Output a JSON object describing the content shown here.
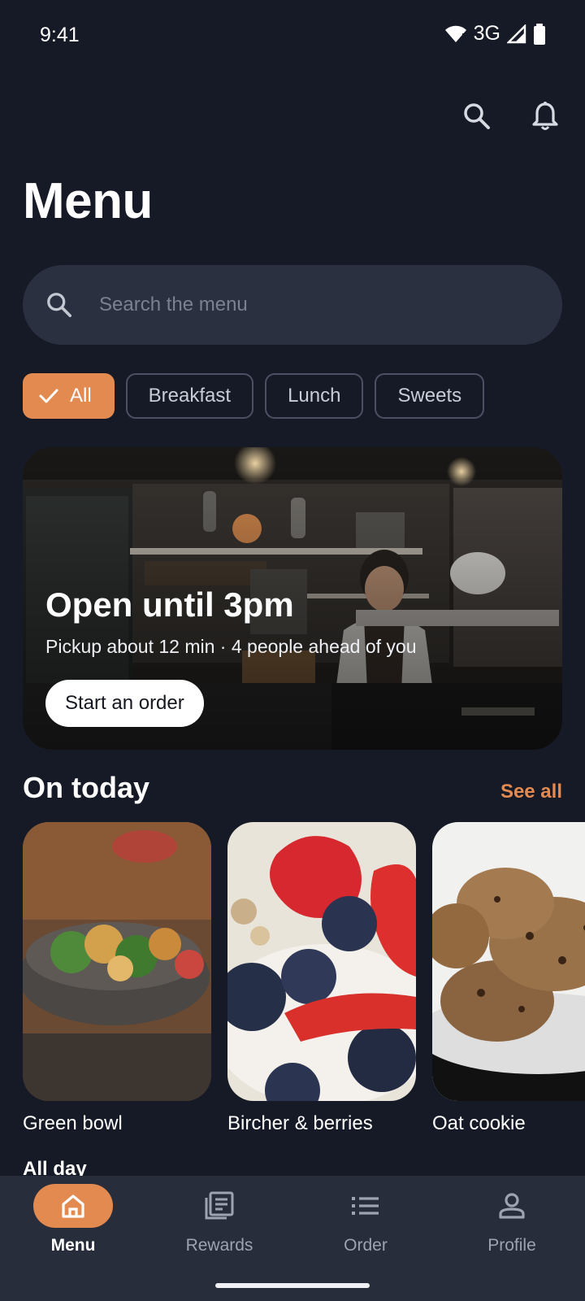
{
  "status_bar": {
    "time": "9:41",
    "network": "3G"
  },
  "header": {
    "title": "Menu"
  },
  "search": {
    "placeholder": "Search the menu"
  },
  "chips": [
    {
      "label": "All",
      "selected": true
    },
    {
      "label": "Breakfast",
      "selected": false
    },
    {
      "label": "Lunch",
      "selected": false
    },
    {
      "label": "Sweets",
      "selected": false
    }
  ],
  "hero": {
    "title": "Open until 3pm",
    "subtitle": "Pickup about 12 min · 4 people ahead of you",
    "button": "Start an order"
  },
  "on_today": {
    "title": "On today",
    "see_all": "See all",
    "items": [
      {
        "label": "Green bowl"
      },
      {
        "label": "Bircher & berries"
      },
      {
        "label": "Oat cookie"
      }
    ]
  },
  "next_section": {
    "title": "All day"
  },
  "nav": {
    "items": [
      {
        "label": "Menu",
        "icon": "home-icon",
        "active": true
      },
      {
        "label": "Rewards",
        "icon": "news-icon",
        "active": false
      },
      {
        "label": "Order",
        "icon": "list-icon",
        "active": false
      },
      {
        "label": "Profile",
        "icon": "person-icon",
        "active": false
      }
    ]
  },
  "colors": {
    "accent": "#e38a50",
    "background": "#161a26",
    "surface": "#2b3040",
    "nav": "#282d3b"
  }
}
